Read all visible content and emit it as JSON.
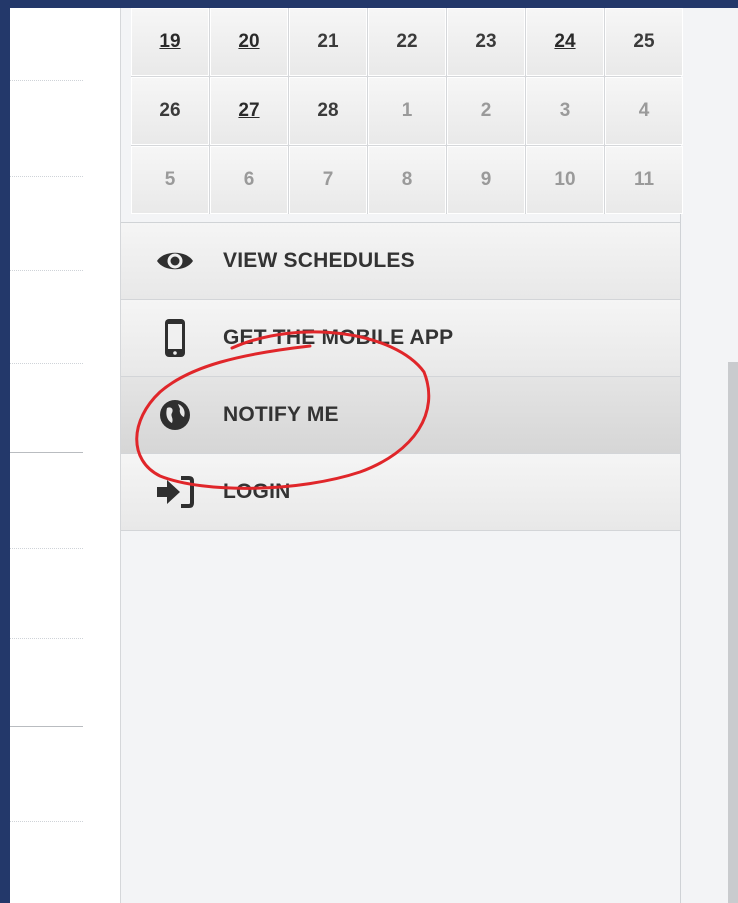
{
  "calendar": {
    "rows": [
      [
        {
          "d": "19",
          "link": true
        },
        {
          "d": "20",
          "link": true
        },
        {
          "d": "21"
        },
        {
          "d": "22"
        },
        {
          "d": "23"
        },
        {
          "d": "24",
          "link": true
        },
        {
          "d": "25"
        }
      ],
      [
        {
          "d": "26"
        },
        {
          "d": "27",
          "link": true
        },
        {
          "d": "28"
        },
        {
          "d": "1",
          "faded": true
        },
        {
          "d": "2",
          "faded": true
        },
        {
          "d": "3",
          "faded": true
        },
        {
          "d": "4",
          "faded": true
        }
      ],
      [
        {
          "d": "5",
          "faded": true
        },
        {
          "d": "6",
          "faded": true
        },
        {
          "d": "7",
          "faded": true
        },
        {
          "d": "8",
          "faded": true
        },
        {
          "d": "9",
          "faded": true
        },
        {
          "d": "10",
          "faded": true
        },
        {
          "d": "11",
          "faded": true
        }
      ]
    ]
  },
  "menu": {
    "items": [
      {
        "label": "VIEW SCHEDULES",
        "icon": "eye-icon",
        "name": "menu-item-view-schedules"
      },
      {
        "label": "GET THE MOBILE APP",
        "icon": "mobile-phone-icon",
        "name": "menu-item-mobile-app"
      },
      {
        "label": "NOTIFY ME",
        "icon": "globe-icon",
        "name": "menu-item-notify-me",
        "active": true
      },
      {
        "label": "LOGIN",
        "icon": "sign-in-icon",
        "name": "menu-item-login"
      }
    ]
  },
  "colors": {
    "frame": "#23386a",
    "annotation": "#e0262a",
    "text": "#333333"
  }
}
